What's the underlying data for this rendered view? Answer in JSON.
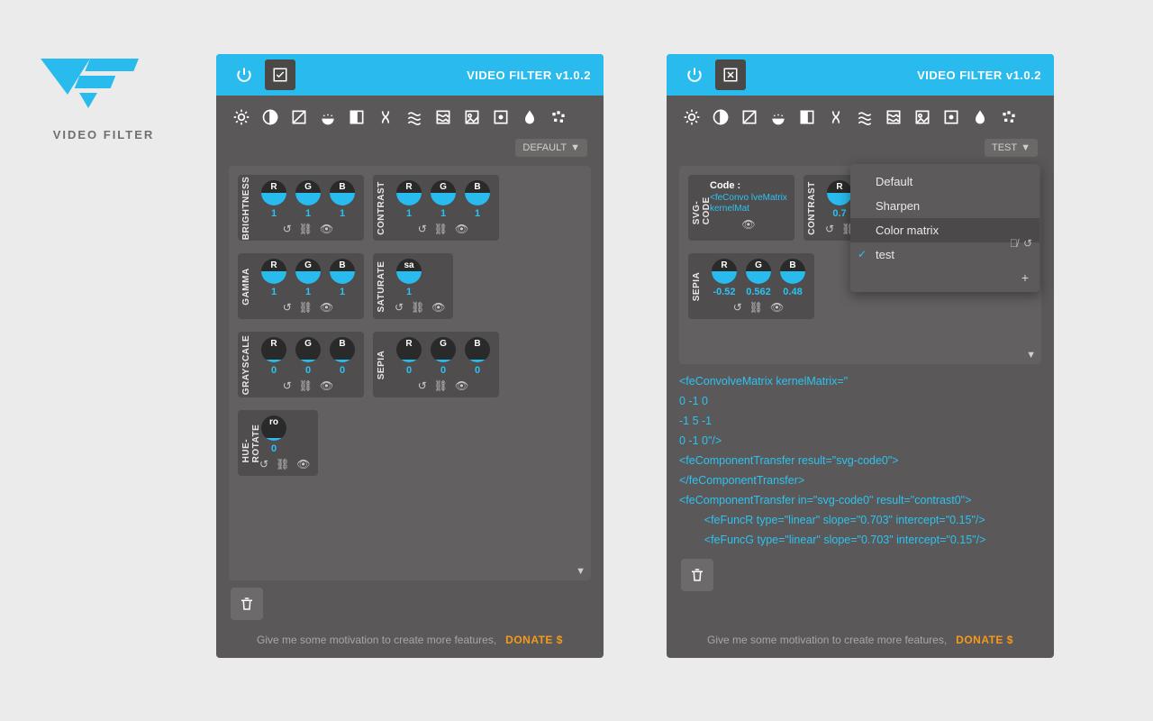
{
  "brand": {
    "name": "VIDEO FILTER"
  },
  "title": "VIDEO FILTER v1.0.2",
  "toolbar_icons": [
    "brightness",
    "contrast",
    "invert",
    "saturate",
    "grayscale",
    "hue",
    "blur",
    "noise",
    "image",
    "pixelate",
    "drop",
    "posterize"
  ],
  "footer": {
    "msg": "Give me some motivation to create more features,",
    "donate": "DONATE $"
  },
  "panel1": {
    "preset": "DEFAULT",
    "rows": [
      [
        {
          "label": "BRIGHTNESS",
          "knobs": [
            {
              "l": "R",
              "v": "1"
            },
            {
              "l": "G",
              "v": "1"
            },
            {
              "l": "B",
              "v": "1"
            }
          ]
        },
        {
          "label": "CONTRAST",
          "knobs": [
            {
              "l": "R",
              "v": "1"
            },
            {
              "l": "G",
              "v": "1"
            },
            {
              "l": "B",
              "v": "1"
            }
          ]
        }
      ],
      [
        {
          "label": "GAMMA",
          "knobs": [
            {
              "l": "R",
              "v": "1"
            },
            {
              "l": "G",
              "v": "1"
            },
            {
              "l": "B",
              "v": "1"
            }
          ]
        },
        {
          "label": "SATURATE",
          "knobs": [
            {
              "l": "sa",
              "v": "1"
            }
          ]
        }
      ],
      [
        {
          "label": "GRAYSCALE",
          "zero": true,
          "knobs": [
            {
              "l": "R",
              "v": "0"
            },
            {
              "l": "G",
              "v": "0"
            },
            {
              "l": "B",
              "v": "0"
            }
          ]
        },
        {
          "label": "SEPIA",
          "zero": true,
          "knobs": [
            {
              "l": "R",
              "v": "0"
            },
            {
              "l": "G",
              "v": "0"
            },
            {
              "l": "B",
              "v": "0"
            }
          ]
        }
      ],
      [
        {
          "label": "HUE-ROTATE",
          "zero": true,
          "knobs": [
            {
              "l": "ro",
              "v": "0"
            }
          ]
        }
      ]
    ]
  },
  "panel2": {
    "preset": "TEST",
    "svgcode": {
      "title": "Code :",
      "body": "<feConvo lveMatrix kernelMat"
    },
    "contrast": {
      "label": "CONTRAST",
      "knobs": [
        {
          "l": "R",
          "v": "0.7"
        }
      ]
    },
    "sepia": {
      "label": "SEPIA",
      "knobs": [
        {
          "l": "R",
          "v": "-0.52"
        },
        {
          "l": "G",
          "v": "0.562"
        },
        {
          "l": "B",
          "v": "0.48"
        }
      ]
    },
    "dropdown": {
      "items": [
        {
          "label": "Default"
        },
        {
          "label": "Sharpen"
        },
        {
          "label": "Color matrix",
          "sel": true,
          "actions": true
        },
        {
          "label": "test",
          "checked": true
        }
      ]
    },
    "code": [
      "<feConvolveMatrix kernelMatrix=\"",
      "0 -1 0",
      "-1 5 -1",
      "0 -1 0\"/>",
      "<feComponentTransfer result=\"svg-code0\">",
      "</feComponentTransfer>",
      "<feComponentTransfer in=\"svg-code0\" result=\"contrast0\">",
      "        <feFuncR type=\"linear\" slope=\"0.703\" intercept=\"0.15\"/>",
      "        <feFuncG type=\"linear\" slope=\"0.703\" intercept=\"0.15\"/>"
    ]
  }
}
